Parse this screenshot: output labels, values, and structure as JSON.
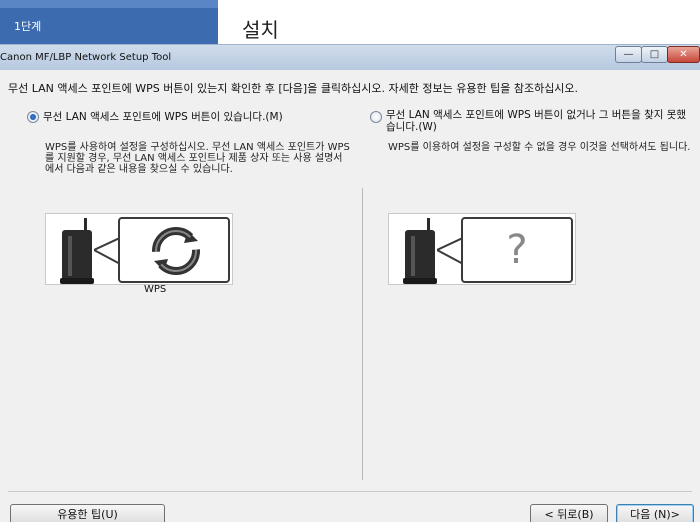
{
  "background_app": {
    "step_label": "1단계",
    "page_title": "설치"
  },
  "dialog": {
    "title": "Canon MF/LBP Network Setup Tool",
    "controls": {
      "minimize": "—",
      "maximize": "□",
      "close": "✕"
    },
    "instruction": "무선 LAN 액세스 포인트에 WPS 버튼이 있는지 확인한 후 [다음]을 클릭하십시오. 자세한 정보는 유용한 팁을 참조하십시오.",
    "options": [
      {
        "label": "무선 LAN 액세스 포인트에 WPS 버튼이 있습니다.(M)",
        "selected": true,
        "description": "WPS를 사용하여 설정을 구성하십시오. 무선 LAN 액세스 포인트가 WPS를 지원할 경우, 무선 LAN 액세스 포인트나 제품 상자 또는 사용 설명서에서 다음과 같은 내용을 찾으실 수 있습니다.",
        "illustration_caption": "WPS",
        "icon": "wps-icon"
      },
      {
        "label": "무선 LAN 액세스 포인트에 WPS 버튼이 없거나 그 버튼을 찾지 못했습니다.(W)",
        "selected": false,
        "description": "WPS를 이용하여 설정을 구성할 수 없을 경우 이것을 선택하셔도 됩니다.",
        "icon": "question-icon",
        "icon_glyph": "?"
      }
    ],
    "buttons": {
      "tips": "유용한 팁(U)",
      "back": "< 뒤로(B)",
      "next": "다음 (N)>"
    }
  }
}
